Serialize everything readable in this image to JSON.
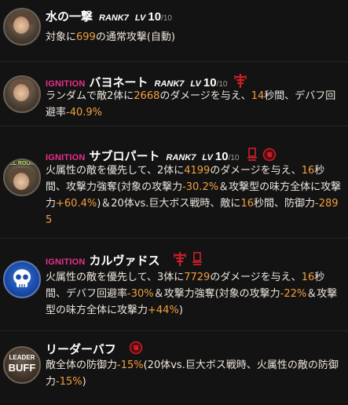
{
  "skills": [
    {
      "ignition": "",
      "name": "水の一撃",
      "rank": "RANK7",
      "lv_label": "LV",
      "lv": "10",
      "lv_max": "/10",
      "icon_badge": "",
      "desc": [
        {
          "t": "対象に"
        },
        {
          "t": "699",
          "h": true
        },
        {
          "t": "の通常攻撃(自動)"
        }
      ]
    },
    {
      "ignition": "IGNITION",
      "name": "バヨネート",
      "rank": "RANK7",
      "lv_label": "LV",
      "lv": "10",
      "lv_max": "/10",
      "icon_badge": "",
      "desc": [
        {
          "t": "ランダムで敵2体に"
        },
        {
          "t": "2668",
          "h": true
        },
        {
          "t": "のダメージを与え、"
        },
        {
          "t": "14",
          "h": true
        },
        {
          "t": "秒間、デバフ回避率"
        },
        {
          "t": "-40.9%",
          "h": true
        }
      ]
    },
    {
      "ignition": "IGNITION",
      "name": "サブロパート",
      "rank": "RANK7",
      "lv_label": "LV",
      "lv": "10",
      "lv_max": "/10",
      "icon_badge": "ALL ROUND",
      "desc": [
        {
          "t": "火属性の敵を優先して、2体に"
        },
        {
          "t": "4199",
          "h": true
        },
        {
          "t": "のダメージを与え、"
        },
        {
          "t": "16",
          "h": true
        },
        {
          "t": "秒間、攻撃力強奪(対象の攻撃力"
        },
        {
          "t": "-30.2%",
          "h": true
        },
        {
          "t": "＆攻撃型の味方全体に攻撃力"
        },
        {
          "t": "+60.4%",
          "h": true
        },
        {
          "t": ")＆20体vs.巨大ボス戦時、敵に"
        },
        {
          "t": "16",
          "h": true
        },
        {
          "t": "秒間、防御力"
        },
        {
          "t": "-2895",
          "h": true
        }
      ]
    },
    {
      "ignition": "IGNITION",
      "name": "カルヴァドス",
      "rank": "",
      "lv_label": "",
      "lv": "",
      "lv_max": "",
      "icon_badge": "",
      "desc": [
        {
          "t": "火属性の敵を優先して、3体に"
        },
        {
          "t": "7729",
          "h": true
        },
        {
          "t": "のダメージを与え、"
        },
        {
          "t": "16",
          "h": true
        },
        {
          "t": "秒間、デバフ回避率"
        },
        {
          "t": "-30%",
          "h": true
        },
        {
          "t": "＆攻撃力強奪(対象の攻撃力"
        },
        {
          "t": "-22%",
          "h": true
        },
        {
          "t": "＆攻撃型の味方全体に攻撃力"
        },
        {
          "t": "+44%",
          "h": true
        },
        {
          "t": ")"
        }
      ]
    },
    {
      "ignition": "",
      "name": "リーダーバフ",
      "rank": "",
      "lv_label": "",
      "lv": "",
      "lv_max": "",
      "icon_badge": "",
      "desc": [
        {
          "t": "敵全体の防御力"
        },
        {
          "t": "-15%",
          "h": true
        },
        {
          "t": "(20体vs.巨大ボス戦時、火属性の敵の防御力"
        },
        {
          "t": "-15%",
          "h": true
        },
        {
          "t": ")"
        }
      ]
    }
  ],
  "leader_icon": {
    "top": "LEADER",
    "bottom": "BUFF"
  },
  "colors": {
    "highlight": "#f0a040",
    "ignition": "#e8308c",
    "emblem": "#c8202a"
  }
}
